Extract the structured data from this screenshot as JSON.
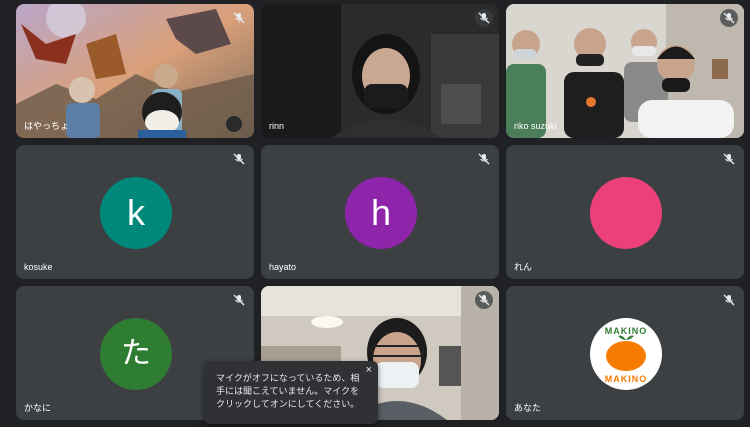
{
  "tiles": [
    {
      "name": "はやっちょ",
      "type": "video"
    },
    {
      "name": "rinn",
      "type": "video"
    },
    {
      "name": "riko suzuki",
      "type": "video"
    },
    {
      "name": "kosuke",
      "type": "avatar",
      "initial": "k",
      "color": "#00897b"
    },
    {
      "name": "hayato",
      "type": "avatar",
      "initial": "h",
      "color": "#8e24aa"
    },
    {
      "name": "れん",
      "type": "avatar",
      "initial": "",
      "color": "#ec407a"
    },
    {
      "name": "かなに",
      "type": "avatar",
      "initial": "た",
      "color": "#2e7d32"
    },
    {
      "name": "",
      "type": "video"
    },
    {
      "name": "あなた",
      "type": "logo",
      "logo_text": {
        "top": "MAKINO",
        "bottom": "MAKINO"
      }
    }
  ],
  "toast": {
    "message": "マイクがオフになっているため、相手には聞こえていません。マイクをクリックしてオンにしてください。",
    "close_symbol": "×"
  },
  "colors": {
    "background": "#202124",
    "tile": "#3c4043",
    "toast": "#303134",
    "logo_orange": "#f57c00",
    "logo_green": "#2e7d32"
  },
  "icons": [
    "mic-off-icon",
    "close-icon"
  ]
}
